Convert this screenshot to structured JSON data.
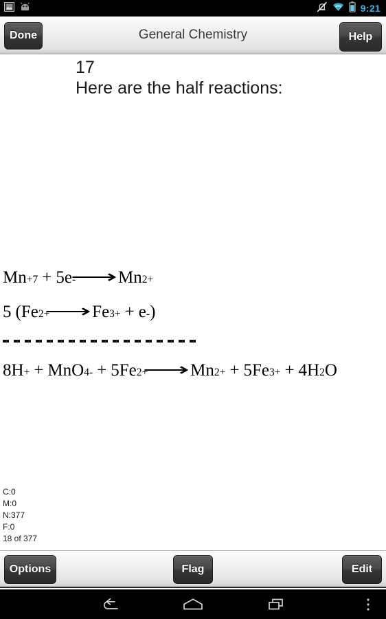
{
  "statusbar": {
    "icons_left": [
      "gallery-image-icon",
      "android-head-icon"
    ],
    "icons_right": [
      "silent-mode-icon",
      "wifi-icon",
      "battery-icon"
    ],
    "time": "9:21",
    "time_color": "#33b5e5"
  },
  "actionbar": {
    "done_label": "Done",
    "title": "General Chemistry",
    "help_label": "Help"
  },
  "content": {
    "question_number": "17",
    "prompt": "Here are the half reactions:",
    "equations": [
      {
        "id": "eq-1",
        "text": "Mn+7 + 5e- ⟶ Mn2+",
        "parts": {
          "reactant_symbol": "Mn",
          "reactant_charge": "+7",
          "plus": "+",
          "electrons": "5e",
          "electron_charge": "-",
          "arrow": "⟶",
          "product_symbol": "Mn",
          "product_charge": "2+"
        }
      },
      {
        "id": "eq-2",
        "text": "5 (Fe2+ ⟶ Fe3+ + e-)",
        "parts": {
          "coefficient": "5",
          "open_paren": "(",
          "reactant_symbol": "Fe",
          "reactant_charge": "2+",
          "arrow": "⟶",
          "product_symbol": "Fe",
          "product_charge": "3+",
          "plus": "+",
          "electron": "e",
          "electron_charge": "-",
          "close_paren": ")"
        }
      },
      {
        "id": "eq-3",
        "text": "8H+ + MnO4- + 5Fe2+ ⟶ Mn2+ + 5Fe3+ + 4H2O",
        "parts": {
          "h_coeff": "8H",
          "h_charge": "+",
          "plus1": "+",
          "mno": "MnO",
          "mno_sub": "4",
          "mno_charge": "-",
          "plus2": "+",
          "fe_reactant": "5Fe",
          "fe_reactant_charge": "2+",
          "arrow": "⟶",
          "mn_product": "Mn",
          "mn_product_charge": "2+",
          "plus3": "+",
          "fe_product": "5Fe",
          "fe_product_charge": "3+",
          "plus4": "+",
          "water_coeff": "4H",
          "water_sub": "2",
          "water_o": "O"
        }
      }
    ],
    "separator": "dashed-line"
  },
  "stats": {
    "correct": "C:0",
    "missed": "M:0",
    "new": "N:377",
    "flagged": "F:0",
    "progress": "18 of 377"
  },
  "bottombar": {
    "options_label": "Options",
    "flag_label": "Flag",
    "edit_label": "Edit"
  },
  "navbar": {
    "back": "back-icon",
    "home": "home-icon",
    "recents": "recents-icon",
    "menu": "overflow-menu-icon"
  }
}
